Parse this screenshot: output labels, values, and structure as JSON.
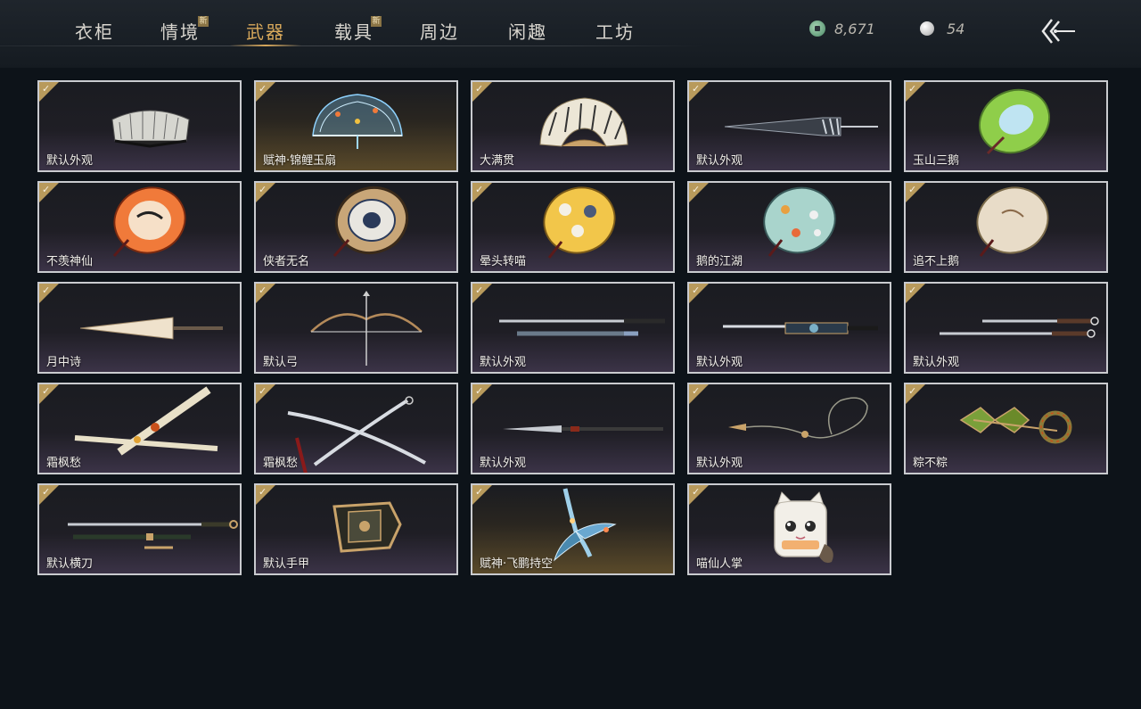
{
  "tabs": [
    {
      "label": "衣柜",
      "badge": ""
    },
    {
      "label": "情境",
      "badge": "新"
    },
    {
      "label": "武器",
      "badge": ""
    },
    {
      "label": "载具",
      "badge": "新"
    },
    {
      "label": "周边",
      "badge": ""
    },
    {
      "label": "闲趣",
      "badge": ""
    },
    {
      "label": "工坊",
      "badge": ""
    }
  ],
  "active_tab": "武器",
  "currency": {
    "jade": {
      "icon": "jade-coin-icon",
      "value": "8,671"
    },
    "pearl": {
      "icon": "pearl-icon",
      "value": "54"
    }
  },
  "back": {
    "icon": "back-arrow-icon"
  },
  "items": [
    {
      "label": "默认外观",
      "icon": "folding-fan-icon",
      "owned": true
    },
    {
      "label": "赋神·锦鲤玉扇",
      "icon": "koi-fan-icon",
      "owned": true
    },
    {
      "label": "大满贯",
      "icon": "calligraphy-fan-icon",
      "owned": true
    },
    {
      "label": "默认外观",
      "icon": "closed-umbrella-icon",
      "owned": true
    },
    {
      "label": "玉山三鹅",
      "icon": "green-umbrella-icon",
      "owned": true
    },
    {
      "label": "不羡神仙",
      "icon": "orange-umbrella-icon",
      "owned": true
    },
    {
      "label": "侠者无名",
      "icon": "patterned-umbrella-icon",
      "owned": true
    },
    {
      "label": "晕头转喵",
      "icon": "yellow-umbrella-icon",
      "owned": true
    },
    {
      "label": "鹅的江湖",
      "icon": "teal-umbrella-icon",
      "owned": true
    },
    {
      "label": "追不上鹅",
      "icon": "beige-umbrella-icon",
      "owned": true
    },
    {
      "label": "月中诗",
      "icon": "folded-umbrella-icon",
      "owned": true
    },
    {
      "label": "默认弓",
      "icon": "bow-icon",
      "owned": true
    },
    {
      "label": "默认外观",
      "icon": "twin-swords-icon",
      "owned": true
    },
    {
      "label": "默认外观",
      "icon": "ornate-sword-icon",
      "owned": true
    },
    {
      "label": "默认外观",
      "icon": "dual-blades-icon",
      "owned": true
    },
    {
      "label": "霜枫愁",
      "icon": "crossed-sheath-icon",
      "owned": true
    },
    {
      "label": "霜枫愁",
      "icon": "crossed-sabers-icon",
      "owned": true
    },
    {
      "label": "默认外观",
      "icon": "spear-icon",
      "owned": true
    },
    {
      "label": "默认外观",
      "icon": "rope-dart-icon",
      "owned": true
    },
    {
      "label": "粽不粽",
      "icon": "zongzi-weapon-icon",
      "owned": true
    },
    {
      "label": "默认横刀",
      "icon": "hengdao-icon",
      "owned": true
    },
    {
      "label": "默认手甲",
      "icon": "gauntlet-icon",
      "owned": true
    },
    {
      "label": "赋神·飞鹏持空",
      "icon": "roc-weapon-icon",
      "owned": true
    },
    {
      "label": "喵仙人掌",
      "icon": "cat-paw-icon",
      "owned": true
    }
  ]
}
